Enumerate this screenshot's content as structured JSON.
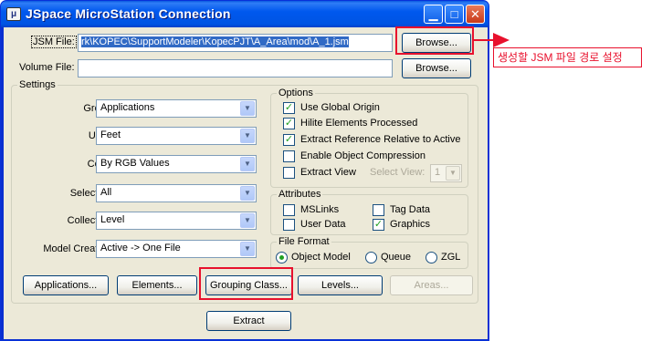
{
  "window": {
    "title": "JSpace MicroStation Connection",
    "icon_text": "μ"
  },
  "files": {
    "jsm_label": "JSM File:",
    "jsm_value": "rk\\KOPEC\\SupportModeler\\KopecPJT\\A_Area\\mod\\A_1.jsm",
    "volume_label": "Volume File:",
    "volume_value": "",
    "browse_label": "Browse...",
    "browse2_label": "Browse..."
  },
  "settings": {
    "title": "Settings",
    "fields": [
      {
        "label": "Group:",
        "value": "Applications"
      },
      {
        "label": "Units:",
        "value": "Feet"
      },
      {
        "label": "Color:",
        "value": "By RGB Values"
      },
      {
        "label": "Selection:",
        "value": "All"
      },
      {
        "label": "Collection:",
        "value": "Level"
      },
      {
        "label": "Model Creation:",
        "value": "Active -> One File"
      }
    ]
  },
  "options": {
    "title": "Options",
    "items": [
      {
        "label": "Use Global Origin",
        "checked": true
      },
      {
        "label": "Hilite Elements Processed",
        "checked": true
      },
      {
        "label": "Extract Reference Relative to Active",
        "checked": true
      },
      {
        "label": "Enable Object Compression",
        "checked": false
      },
      {
        "label": "Extract View",
        "checked": false
      }
    ],
    "select_view_label": "Select View:",
    "select_view_value": "1"
  },
  "attributes": {
    "title": "Attributes",
    "items": [
      {
        "label": "MSLinks",
        "checked": false
      },
      {
        "label": "Tag Data",
        "checked": false
      },
      {
        "label": "User Data",
        "checked": false
      },
      {
        "label": "Graphics",
        "checked": true
      }
    ]
  },
  "file_format": {
    "title": "File Format",
    "options": [
      {
        "label": "Object Model",
        "selected": true
      },
      {
        "label": "Queue",
        "selected": false
      },
      {
        "label": "ZGL",
        "selected": false
      }
    ]
  },
  "buttons": {
    "applications": "Applications...",
    "elements": "Elements...",
    "grouping_class": "Grouping Class...",
    "levels": "Levels...",
    "areas": "Areas...",
    "extract": "Extract"
  },
  "annotation": {
    "callout_text": "생성할 JSM 파일 경로 설정",
    "color": "#e8112d"
  },
  "colors": {
    "titlebar": "#0054e3",
    "dialog_bg": "#ece9d8",
    "selection": "#316ac5",
    "check": "#21a121"
  }
}
